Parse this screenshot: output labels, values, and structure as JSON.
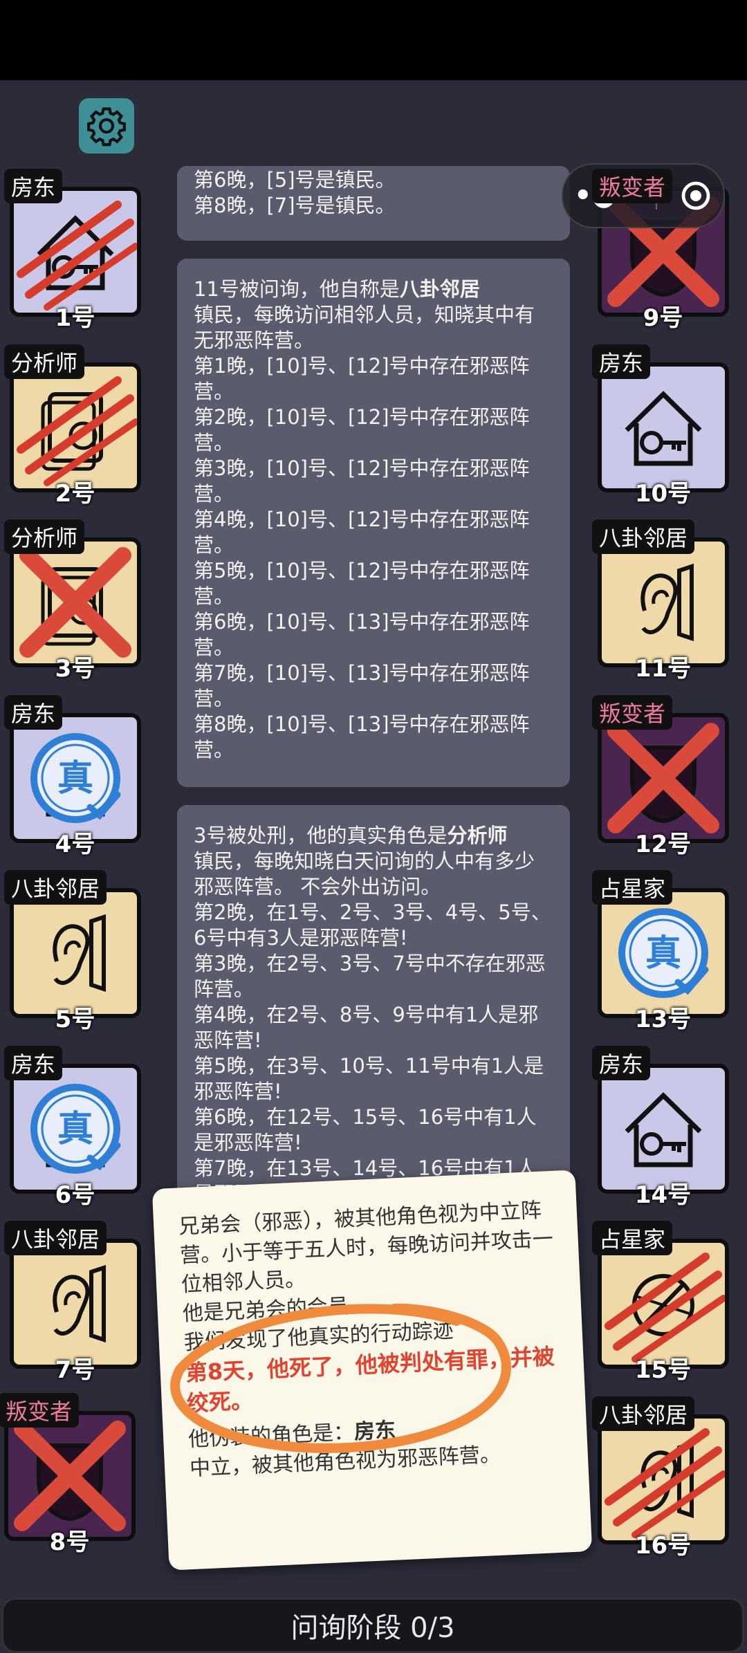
{
  "capsule": {
    "more_icon": "more-dots-icon",
    "close_icon": "target-icon"
  },
  "players_left": [
    {
      "label": "房东",
      "num": "1号",
      "bg": "lav",
      "icon": "house-key-icon",
      "state": "dead-scratch"
    },
    {
      "label": "分析师",
      "num": "2号",
      "bg": "tan",
      "icon": "analyst-icon",
      "state": "dead-scratch"
    },
    {
      "label": "分析师",
      "num": "3号",
      "bg": "tan",
      "icon": "analyst-icon",
      "state": "executed-x"
    },
    {
      "label": "房东",
      "num": "4号",
      "bg": "lav",
      "icon": "house-key-icon",
      "state": "true-badge",
      "badge": "真"
    },
    {
      "label": "八卦邻居",
      "num": "5号",
      "bg": "tan",
      "icon": "ear-icon",
      "state": "alive"
    },
    {
      "label": "房东",
      "num": "6号",
      "bg": "lav",
      "icon": "house-key-icon",
      "state": "true-badge",
      "badge": "真"
    },
    {
      "label": "八卦邻居",
      "num": "7号",
      "bg": "tan",
      "icon": "ear-icon",
      "state": "alive"
    },
    {
      "label": "叛变者",
      "num": "8号",
      "bg": "pur",
      "icon": "mask-icon",
      "state": "executed-x",
      "red": true
    }
  ],
  "players_right": [
    {
      "label": "叛变者",
      "num": "9号",
      "bg": "pur",
      "icon": "mask-icon",
      "state": "executed-x",
      "red": true
    },
    {
      "label": "房东",
      "num": "10号",
      "bg": "lav",
      "icon": "house-key-icon",
      "state": "alive"
    },
    {
      "label": "八卦邻居",
      "num": "11号",
      "bg": "tan",
      "icon": "ear-icon",
      "state": "alive"
    },
    {
      "label": "叛变者",
      "num": "12号",
      "bg": "pur",
      "icon": "mask-icon",
      "state": "executed-x",
      "red": true
    },
    {
      "label": "占星家",
      "num": "13号",
      "bg": "tan",
      "icon": "astrologer-icon",
      "state": "true-badge",
      "badge": "真"
    },
    {
      "label": "房东",
      "num": "14号",
      "bg": "lav",
      "icon": "house-key-icon",
      "state": "alive"
    },
    {
      "label": "占星家",
      "num": "15号",
      "bg": "tan",
      "icon": "astrologer-icon",
      "state": "dead-scratch"
    },
    {
      "label": "八卦邻居",
      "num": "16号",
      "bg": "tan",
      "icon": "ear-icon",
      "state": "dead-scratch"
    }
  ],
  "panel_top": {
    "lines": [
      "第6晚，[5]号是镇民。",
      "第8晚，[7]号是镇民。"
    ]
  },
  "panel_mid": {
    "intro_prefix": "11号被问询，他自称是",
    "intro_role": "八卦邻居",
    "desc": "镇民，每晚访问相邻人员，知晓其中有无邪恶阵营。",
    "lines": [
      "第1晚，[10]号、[12]号中存在邪恶阵营。",
      "第2晚，[10]号、[12]号中存在邪恶阵营。",
      "第3晚，[10]号、[12]号中存在邪恶阵营。",
      "第4晚，[10]号、[12]号中存在邪恶阵营。",
      "第5晚，[10]号、[12]号中存在邪恶阵营。",
      "第6晚，[10]号、[13]号中存在邪恶阵营。",
      "第7晚，[10]号、[13]号中存在邪恶阵营。",
      "第8晚，[10]号、[13]号中存在邪恶阵营。"
    ]
  },
  "panel_low": {
    "intro_prefix": "3号被处刑，他的真实角色是",
    "intro_role": "分析师",
    "desc": "镇民，每晚知晓白天问询的人中有多少邪恶阵营。 不会外出访问。",
    "lines": [
      "第2晚，在1号、2号、3号、4号、5号、6号中有3人是邪恶阵营!",
      "第3晚，在2号、3号、7号中不存在邪恶阵营。",
      "第4晚，在2号、8号、9号中有1人是邪恶阵营!",
      "第5晚，在3号、10号、11号中有1人是邪恶阵营!",
      "第6晚，在12号、15号、16号中有1人是邪恶阵营!",
      "第7晚，在13号、14号、16号中有1人是邪恶阵营!"
    ]
  },
  "popup": {
    "p1": "兄弟会（邪恶），被其他角色视为中立阵营。小于等于五人时，每晚访问并攻击一位相邻人员。",
    "p2": "他是兄弟会的会员。",
    "p3": "我们发现了他真实的行动踪迹",
    "red": "第8天，他死了，他被判处有罪，并被绞死。",
    "p4_prefix": "他伪装的角色是：",
    "p4_role": "房东",
    "p5": "中立，被其他角色视为邪恶阵营。"
  },
  "bottom_bar": {
    "text": "问询阶段 0/3"
  },
  "colors": {
    "scratch": "#d63c2c",
    "badge": "#2f7fd6",
    "x": "#d94a3a"
  }
}
